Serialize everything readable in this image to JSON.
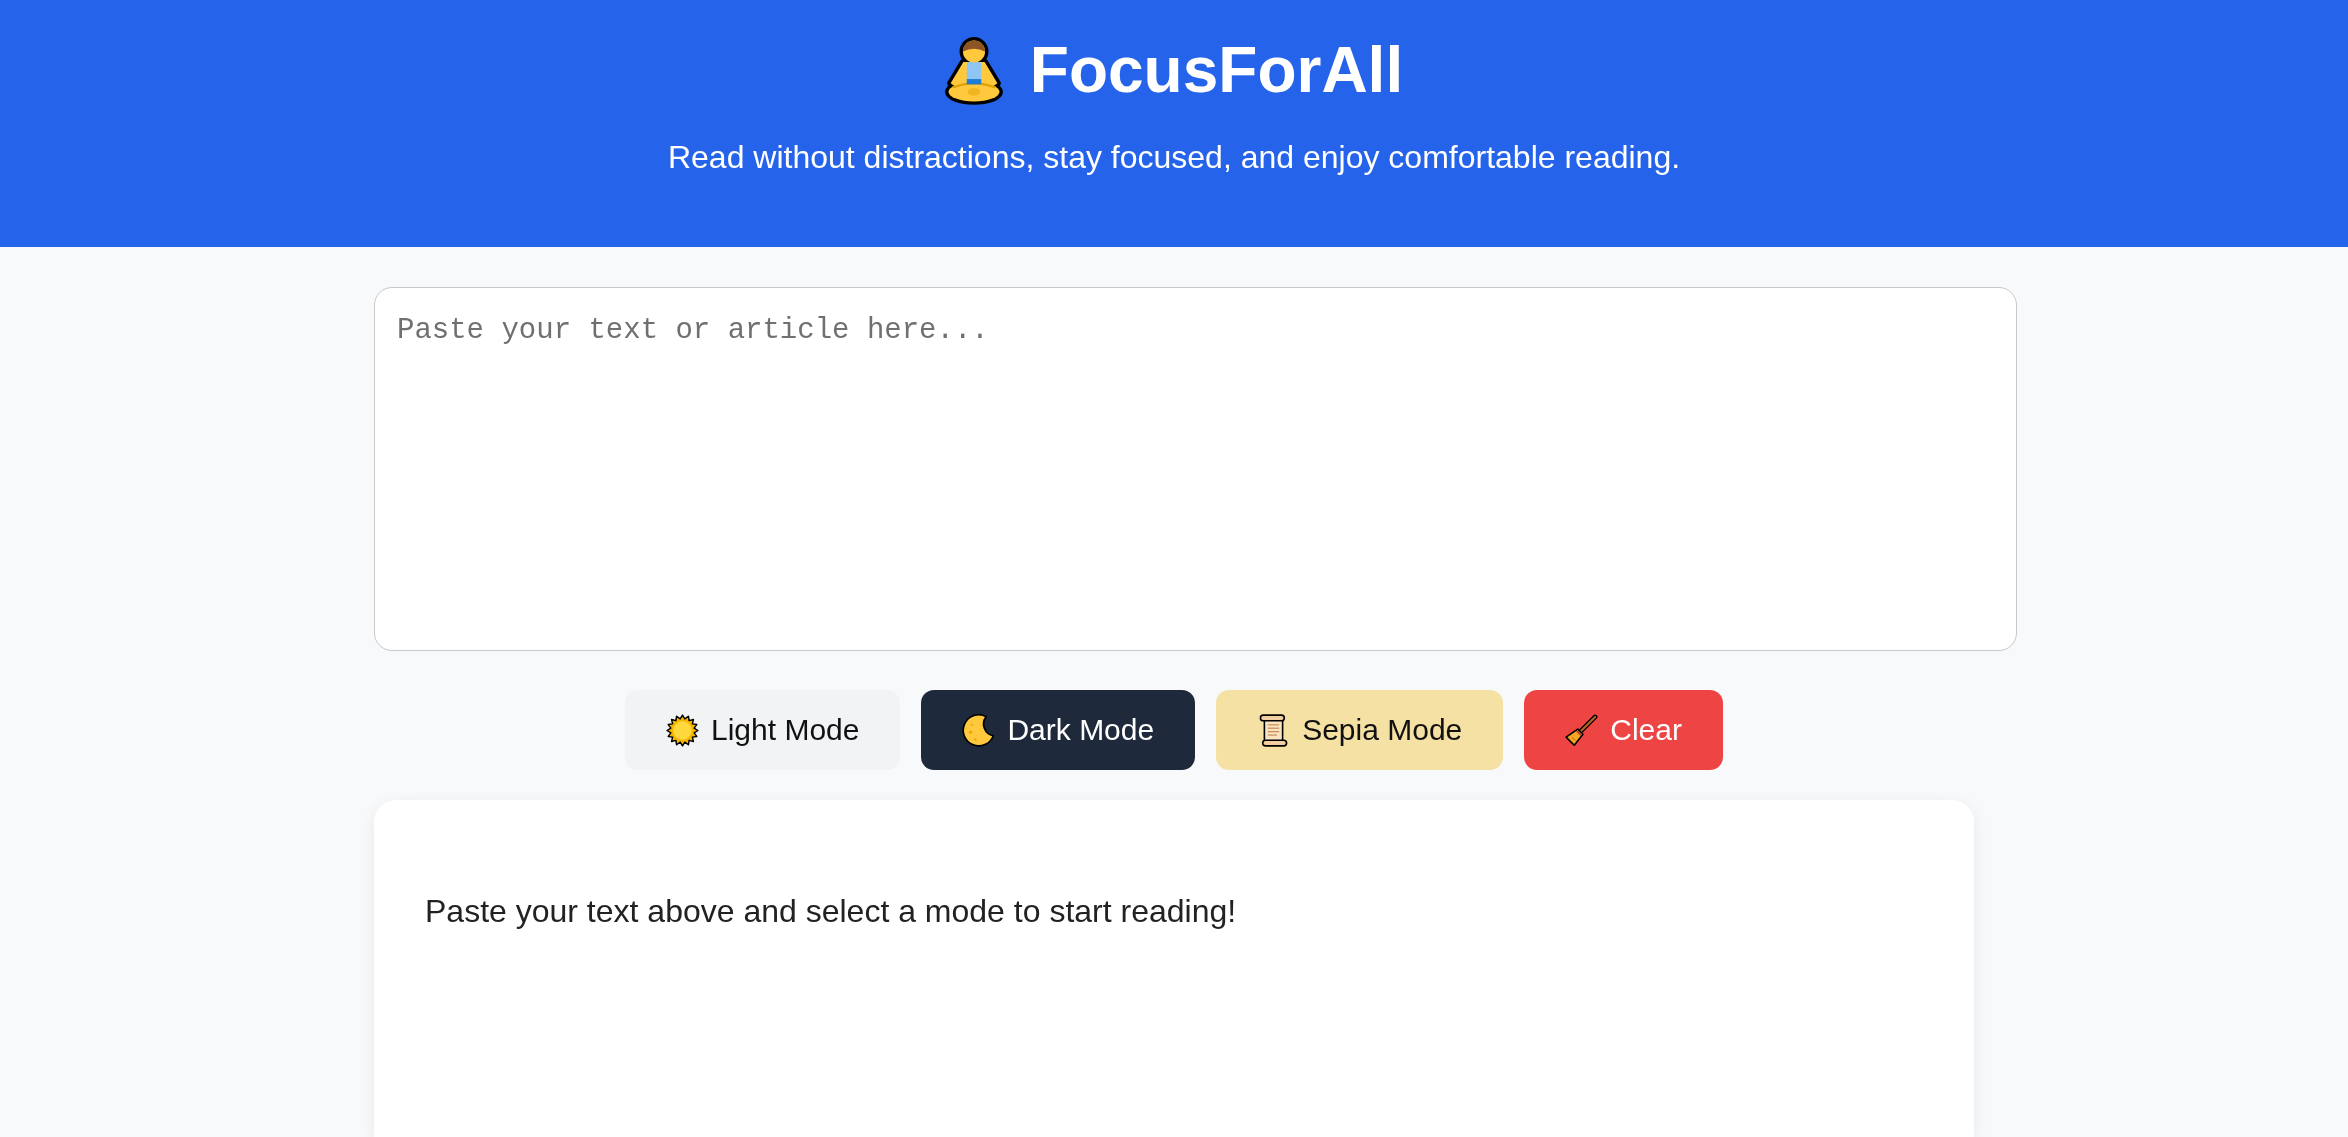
{
  "header": {
    "title": "FocusForAll",
    "subtitle": "Read without distractions, stay focused, and enjoy comfortable reading."
  },
  "input": {
    "placeholder": "Paste your text or article here..."
  },
  "buttons": [
    {
      "kind": "light",
      "label": "Light Mode"
    },
    {
      "kind": "dark",
      "label": "Dark Mode"
    },
    {
      "kind": "sepia",
      "label": "Sepia Mode"
    },
    {
      "kind": "clear",
      "label": "Clear"
    }
  ],
  "reader": {
    "text": "Paste your text above and select a mode to start reading!"
  }
}
